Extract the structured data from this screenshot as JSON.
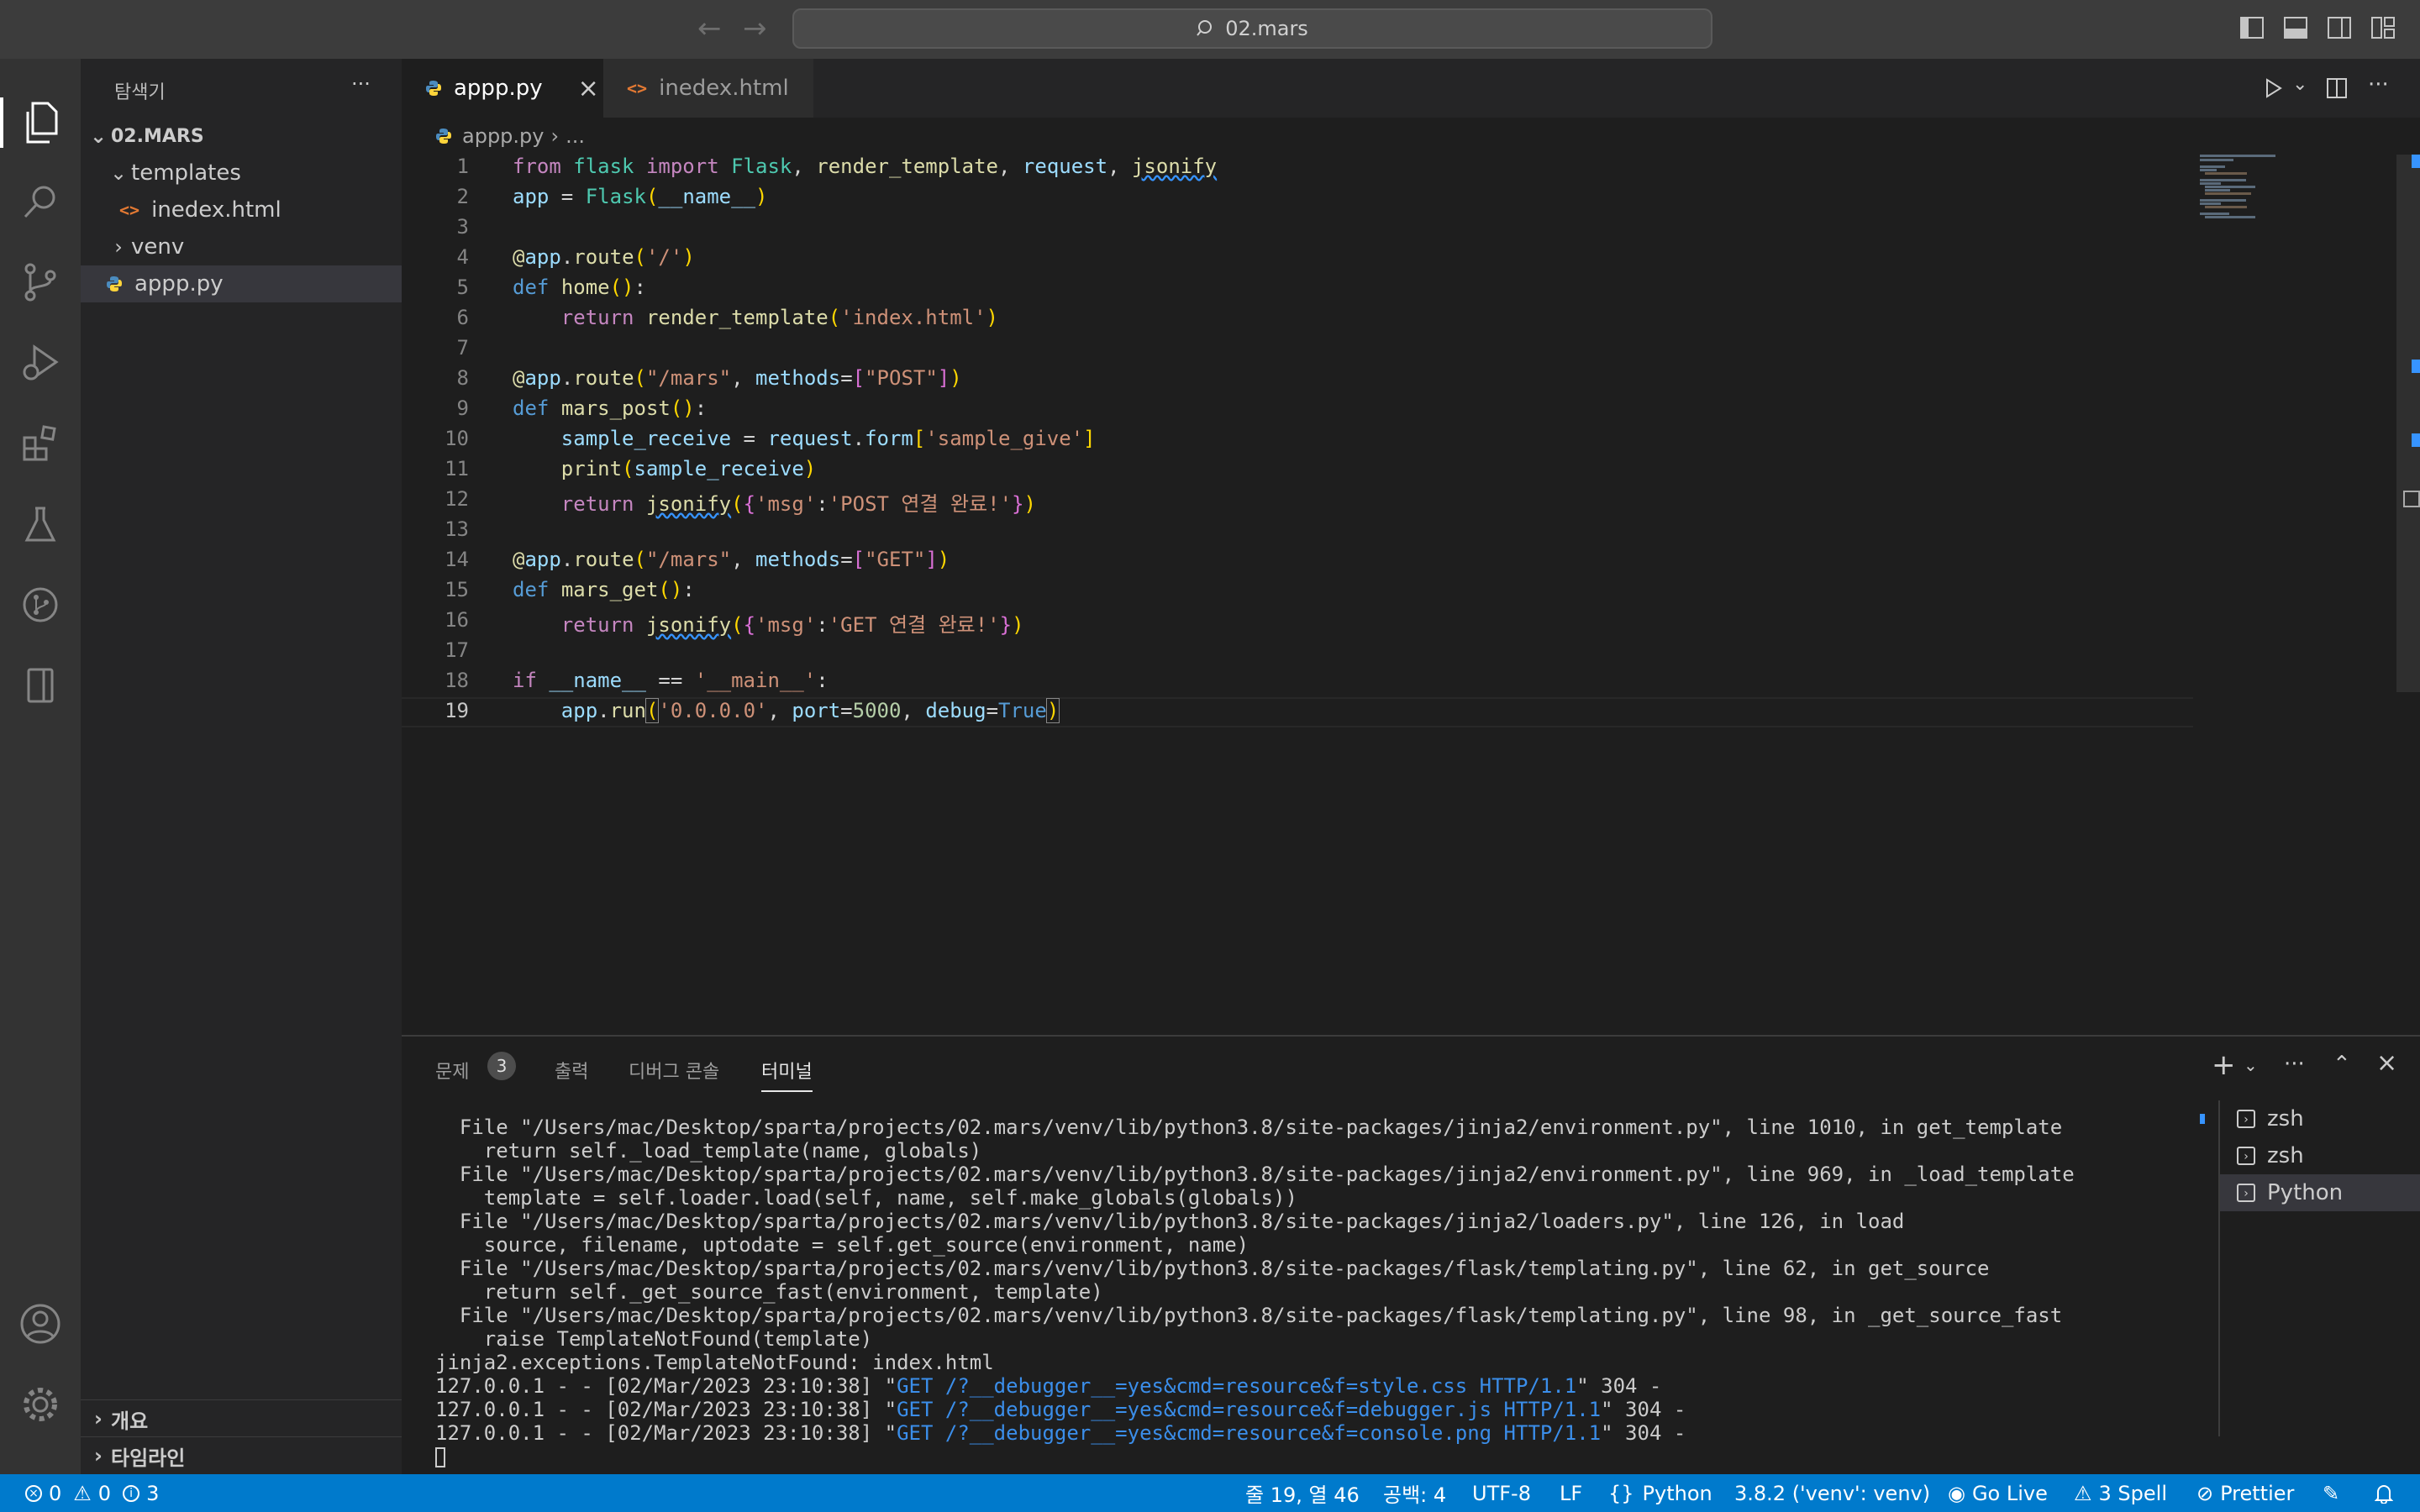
{
  "window": {
    "title": "02.mars",
    "back_icon": "arrow-left-icon",
    "forward_icon": "arrow-right-icon"
  },
  "sidebar": {
    "title": "탐색기",
    "more": "···",
    "root": "02.MARS",
    "items": [
      {
        "label": "templates",
        "type": "folder",
        "expanded": true
      },
      {
        "label": "inedex.html",
        "type": "html"
      },
      {
        "label": "venv",
        "type": "folder",
        "expanded": false
      },
      {
        "label": "appp.py",
        "type": "python",
        "selected": true
      }
    ],
    "bottom": [
      {
        "label": "개요"
      },
      {
        "label": "타임라인"
      }
    ]
  },
  "tabs": [
    {
      "label": "appp.py",
      "active": true,
      "close": "×"
    },
    {
      "label": "inedex.html",
      "active": false
    }
  ],
  "breadcrumb": {
    "file": "appp.py",
    "rest": "..."
  },
  "code": {
    "lines": [
      "1",
      "2",
      "3",
      "4",
      "5",
      "6",
      "7",
      "8",
      "9",
      "10",
      "11",
      "12",
      "13",
      "14",
      "15",
      "16",
      "17",
      "18",
      "19"
    ],
    "current_line": "19"
  },
  "panel": {
    "tabs": [
      {
        "label": "문제",
        "badge": "3"
      },
      {
        "label": "출력"
      },
      {
        "label": "디버그 콘솔"
      },
      {
        "label": "터미널",
        "active": true
      }
    ],
    "terminal_lines": [
      "  File \"/Users/mac/Desktop/sparta/projects/02.mars/venv/lib/python3.8/site-packages/jinja2/environment.py\", line 1010, in get_template",
      "    return self._load_template(name, globals)",
      "  File \"/Users/mac/Desktop/sparta/projects/02.mars/venv/lib/python3.8/site-packages/jinja2/environment.py\", line 969, in _load_template",
      "    template = self.loader.load(self, name, self.make_globals(globals))",
      "  File \"/Users/mac/Desktop/sparta/projects/02.mars/venv/lib/python3.8/site-packages/jinja2/loaders.py\", line 126, in load",
      "    source, filename, uptodate = self.get_source(environment, name)",
      "  File \"/Users/mac/Desktop/sparta/projects/02.mars/venv/lib/python3.8/site-packages/flask/templating.py\", line 62, in get_source",
      "    return self._get_source_fast(environment, template)",
      "  File \"/Users/mac/Desktop/sparta/projects/02.mars/venv/lib/python3.8/site-packages/flask/templating.py\", line 98, in _get_source_fast",
      "    raise TemplateNotFound(template)",
      "jinja2.exceptions.TemplateNotFound: index.html"
    ],
    "request_lines": [
      {
        "prefix": "127.0.0.1 - - [02/Mar/2023 23:10:38] \"",
        "link": "GET /?__debugger__=yes&cmd=resource&f=style.css HTTP/1.1",
        "suffix": "\" 304 -"
      },
      {
        "prefix": "127.0.0.1 - - [02/Mar/2023 23:10:38] \"",
        "link": "GET /?__debugger__=yes&cmd=resource&f=debugger.js HTTP/1.1",
        "suffix": "\" 304 -"
      },
      {
        "prefix": "127.0.0.1 - - [02/Mar/2023 23:10:38] \"",
        "link": "GET /?__debugger__=yes&cmd=resource&f=console.png HTTP/1.1",
        "suffix": "\" 304 -"
      }
    ],
    "terminals": [
      {
        "label": "zsh"
      },
      {
        "label": "zsh"
      },
      {
        "label": "Python",
        "selected": true
      }
    ]
  },
  "status": {
    "errors": "0",
    "warnings": "0",
    "infos": "3",
    "cursor": "줄 19, 열 46",
    "spaces": "공백: 4",
    "encoding": "UTF-8",
    "eol": "LF",
    "language": "Python",
    "interpreter": "3.8.2 ('venv': venv)",
    "golive": "Go Live",
    "spell": "3 Spell",
    "prettier": "Prettier"
  },
  "colors": {
    "accent": "#007acc",
    "editor_bg": "#1e1e1e",
    "sidebar_bg": "#252526",
    "activity_bg": "#333333"
  }
}
